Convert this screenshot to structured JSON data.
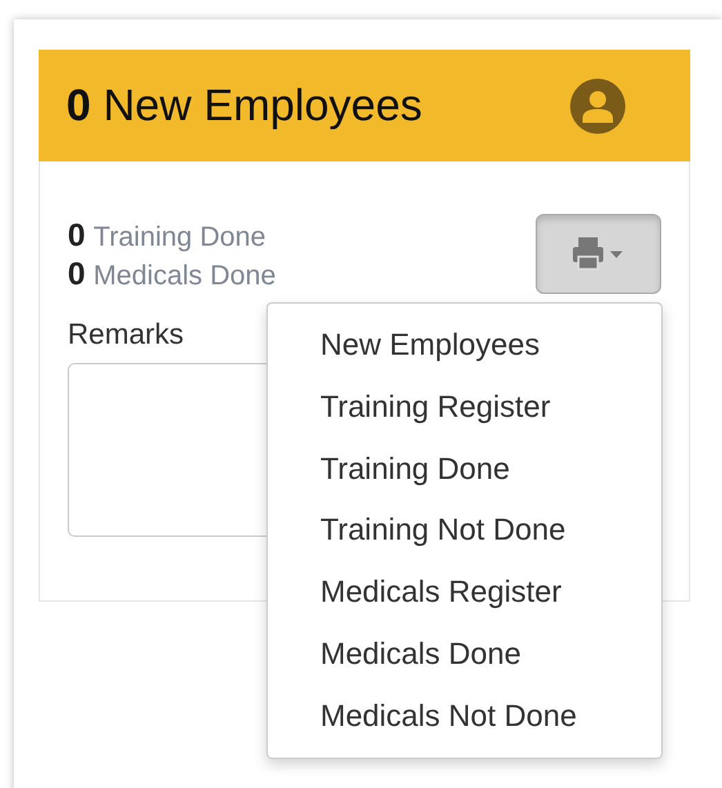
{
  "panel": {
    "count": "0",
    "title": "New Employees"
  },
  "stats": [
    {
      "count": "0",
      "label": "Training Done"
    },
    {
      "count": "0",
      "label": "Medicals Done"
    }
  ],
  "print_button": {
    "expanded": true
  },
  "remarks": {
    "label": "Remarks"
  },
  "print_menu": [
    "New Employees",
    "Training Register",
    "Training Done",
    "Training Not Done",
    "Medicals Register",
    "Medicals Done",
    "Medicals Not Done"
  ]
}
